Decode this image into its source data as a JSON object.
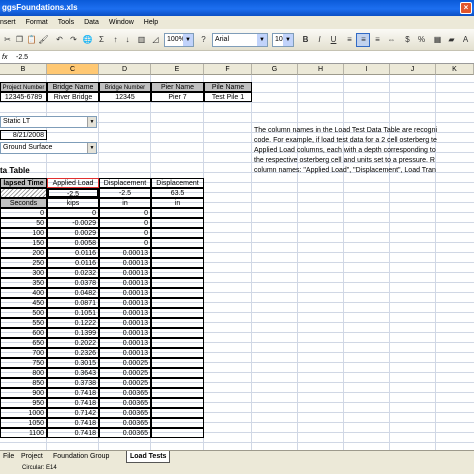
{
  "window": {
    "title": "ggsFoundations.xls",
    "close_glyph": "×"
  },
  "menu": [
    "nsert",
    "Format",
    "Tools",
    "Data",
    "Window",
    "Help"
  ],
  "toolbar": {
    "zoom": "100%",
    "font": "Arial",
    "font_size": "10",
    "bold": "B",
    "italic": "I",
    "underline": "U",
    "sigma": "Σ",
    "currency": "$",
    "percent": "%"
  },
  "formula": {
    "fx": "fx",
    "value": "-2.5"
  },
  "columns": [
    "B",
    "C",
    "D",
    "E",
    "F",
    "G",
    "H",
    "I",
    "J",
    "K"
  ],
  "selected_column": "C",
  "project_table": {
    "headers": [
      "Project Number",
      "Bridge Name",
      "Bridge Number",
      "Pier Name",
      "Pile Name"
    ],
    "values": [
      "12345-6789",
      "River Bridge",
      "12345",
      "Pier 7",
      "Test Pile 1"
    ]
  },
  "test_type": "Static LT",
  "test_date": "8/21/2008",
  "ref_level": "Ground Surface",
  "note_lines": [
    "The column names in the Load Test Data Table are recogni",
    "code.  For example, if load test data for a 2 cell osterberg te",
    "Applied Load columns, each with a depth corresponding to",
    "the respective osterberg cell and units set to a pressure.  R",
    "column names:  \"Applied Load\", \"Displacement\", Load Tran"
  ],
  "data_table": {
    "title": "ta Table",
    "headers": [
      "lapsed Time",
      "Applied Load",
      "Displacement",
      "Displacement"
    ],
    "depth_row": [
      "",
      "-2.5",
      "-2.5",
      "63.5"
    ],
    "units_row": [
      "Seconds",
      "kips",
      "in",
      "in"
    ],
    "rows": [
      [
        "0",
        "0",
        "0"
      ],
      [
        "50",
        "-0.0029",
        "0"
      ],
      [
        "100",
        "0.0029",
        "0"
      ],
      [
        "150",
        "0.0058",
        "0"
      ],
      [
        "200",
        "0.0116",
        "0.00013"
      ],
      [
        "250",
        "0.0116",
        "0.00013"
      ],
      [
        "300",
        "0.0232",
        "0.00013"
      ],
      [
        "350",
        "0.0378",
        "0.00013"
      ],
      [
        "400",
        "0.0482",
        "0.00013"
      ],
      [
        "450",
        "0.0871",
        "0.00013"
      ],
      [
        "500",
        "0.1051",
        "0.00013"
      ],
      [
        "550",
        "0.1222",
        "0.00013"
      ],
      [
        "600",
        "0.1399",
        "0.00013"
      ],
      [
        "650",
        "0.2022",
        "0.00013"
      ],
      [
        "700",
        "0.2326",
        "0.00013"
      ],
      [
        "750",
        "0.3015",
        "0.00025"
      ],
      [
        "800",
        "0.3643",
        "0.00025"
      ],
      [
        "850",
        "0.3738",
        "0.00025"
      ],
      [
        "900",
        "0.7418",
        "0.00365"
      ],
      [
        "950",
        "0.7418",
        "0.00365"
      ],
      [
        "1000",
        "0.7142",
        "0.00365"
      ],
      [
        "1050",
        "0.7418",
        "0.00365"
      ],
      [
        "1100",
        "0.7418",
        "0.00365"
      ]
    ]
  },
  "sheet_tabs": [
    "File",
    "Project",
    "Foundation Group",
    "Load Tests"
  ],
  "active_tab": "Load Tests",
  "status": "Circular: E14"
}
